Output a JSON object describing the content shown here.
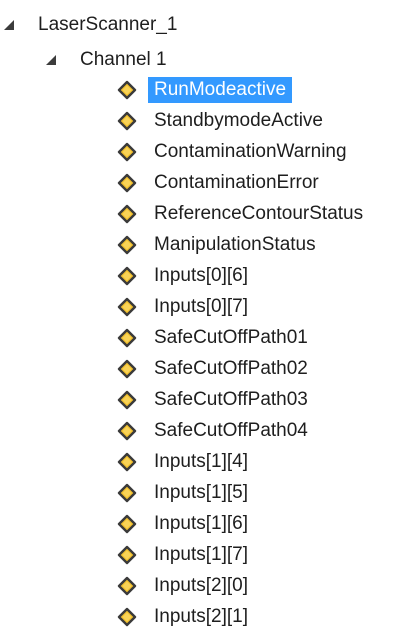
{
  "tree": {
    "root": {
      "label": "LaserScanner_1",
      "expanded": true,
      "icon": "expanded-triangle-icon"
    },
    "channel": {
      "label": "Channel 1",
      "expanded": true,
      "icon": "expanded-triangle-icon"
    },
    "variables": [
      {
        "label": "RunModeactive",
        "selected": true,
        "icon": "variable-diamond-icon"
      },
      {
        "label": "StandbymodeActive",
        "selected": false,
        "icon": "variable-diamond-icon"
      },
      {
        "label": "ContaminationWarning",
        "selected": false,
        "icon": "variable-diamond-icon"
      },
      {
        "label": "ContaminationError",
        "selected": false,
        "icon": "variable-diamond-icon"
      },
      {
        "label": "ReferenceContourStatus",
        "selected": false,
        "icon": "variable-diamond-icon"
      },
      {
        "label": "ManipulationStatus",
        "selected": false,
        "icon": "variable-diamond-icon"
      },
      {
        "label": "Inputs[0][6]",
        "selected": false,
        "icon": "variable-diamond-icon"
      },
      {
        "label": "Inputs[0][7]",
        "selected": false,
        "icon": "variable-diamond-icon"
      },
      {
        "label": "SafeCutOffPath01",
        "selected": false,
        "icon": "variable-diamond-icon"
      },
      {
        "label": "SafeCutOffPath02",
        "selected": false,
        "icon": "variable-diamond-icon"
      },
      {
        "label": "SafeCutOffPath03",
        "selected": false,
        "icon": "variable-diamond-icon"
      },
      {
        "label": "SafeCutOffPath04",
        "selected": false,
        "icon": "variable-diamond-icon"
      },
      {
        "label": "Inputs[1][4]",
        "selected": false,
        "icon": "variable-diamond-icon"
      },
      {
        "label": "Inputs[1][5]",
        "selected": false,
        "icon": "variable-diamond-icon"
      },
      {
        "label": "Inputs[1][6]",
        "selected": false,
        "icon": "variable-diamond-icon"
      },
      {
        "label": "Inputs[1][7]",
        "selected": false,
        "icon": "variable-diamond-icon"
      },
      {
        "label": "Inputs[2][0]",
        "selected": false,
        "icon": "variable-diamond-icon"
      },
      {
        "label": "Inputs[2][1]",
        "selected": false,
        "icon": "variable-diamond-icon"
      }
    ],
    "colors": {
      "selection": "#3399ff",
      "selectedText": "#ffffff",
      "text": "#1e1e1e",
      "diamondFill": "#f2c12e",
      "diamondStroke": "#3a3a3a"
    }
  }
}
